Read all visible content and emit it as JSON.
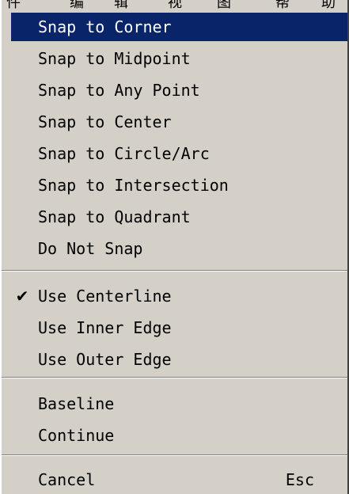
{
  "top_strip_fragments": [
    "件",
    "编",
    "辑",
    "视",
    "图",
    "帮",
    "助"
  ],
  "menu": {
    "snap_items": [
      "Snap to Corner",
      "Snap to Midpoint",
      "Snap to Any Point",
      "Snap to Center",
      "Snap to Circle/Arc",
      "Snap to Intersection",
      "Snap to Quadrant",
      "Do Not Snap"
    ],
    "edge_items": [
      "Use Centerline",
      "Use Inner Edge",
      "Use Outer Edge"
    ],
    "check_mark": "✔",
    "action_items": [
      "Baseline",
      "Continue"
    ],
    "cancel": {
      "label": "Cancel",
      "shortcut": "Esc"
    }
  },
  "colors": {
    "menu_background": "#d4d0c8",
    "highlight": "#0a246a",
    "highlight_text": "#ffffff"
  }
}
